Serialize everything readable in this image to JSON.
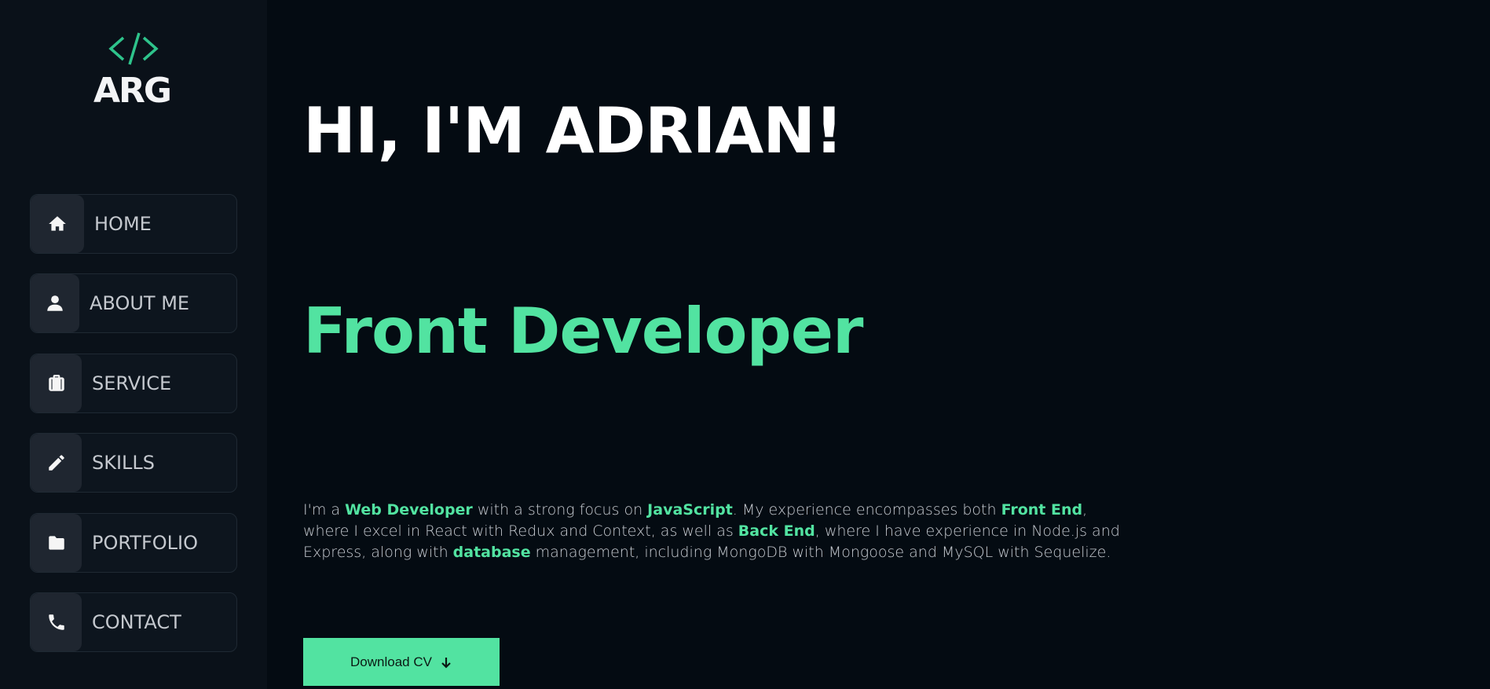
{
  "logo": {
    "code_glyph": "</>",
    "text": "ARG",
    "accent": "#2ec38b"
  },
  "nav": {
    "items": [
      {
        "label": "HOME",
        "icon": "home-icon"
      },
      {
        "label": "ABOUT ME",
        "icon": "user-icon"
      },
      {
        "label": "SERVICE",
        "icon": "briefcase-icon"
      },
      {
        "label": "SKILLS",
        "icon": "pencil-icon"
      },
      {
        "label": "PORTFOLIO",
        "icon": "folder-icon"
      },
      {
        "label": "CONTACT",
        "icon": "phone-icon"
      }
    ]
  },
  "hero": {
    "title": "HI, I'M ADRIAN!",
    "role": "Front Developer",
    "bio": {
      "t1": "I'm a ",
      "h1": "Web Developer",
      "t2": " with a strong focus on ",
      "h2": "JavaScript",
      "t3": ". My experience encompasses both ",
      "h3": "Front End",
      "t4": ", where I excel in React with Redux and Context, as well as ",
      "h4": "Back End",
      "t5": ", where I have experience in Node.js and Express, along with ",
      "h5": "database",
      "t6": " management, including MongoDB with Mongoose and MySQL with Sequelize."
    },
    "cv_button": "Download CV"
  },
  "colors": {
    "accent": "#52e3a1",
    "background": "#040b12",
    "sidebar": "#0a1119"
  }
}
